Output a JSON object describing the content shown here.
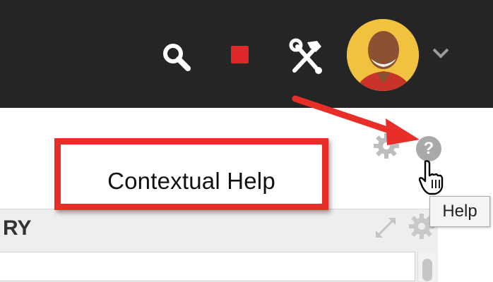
{
  "header": {
    "icons": [
      "search-icon",
      "record-icon",
      "tools-icon",
      "chevron-down-icon"
    ],
    "avatar": "user-avatar"
  },
  "annotation": {
    "callout_text": "Contextual Help",
    "arrow_color": "#e82e28",
    "box_color": "#e82e28"
  },
  "help": {
    "icon_glyph": "?",
    "tooltip": "Help"
  },
  "panel": {
    "title_fragment": "RY",
    "icons": [
      "expand-icon",
      "gear-icon"
    ]
  },
  "colors": {
    "header_bg": "#252525",
    "record": "#e0282a",
    "avatar_bg": "#f0c240"
  }
}
